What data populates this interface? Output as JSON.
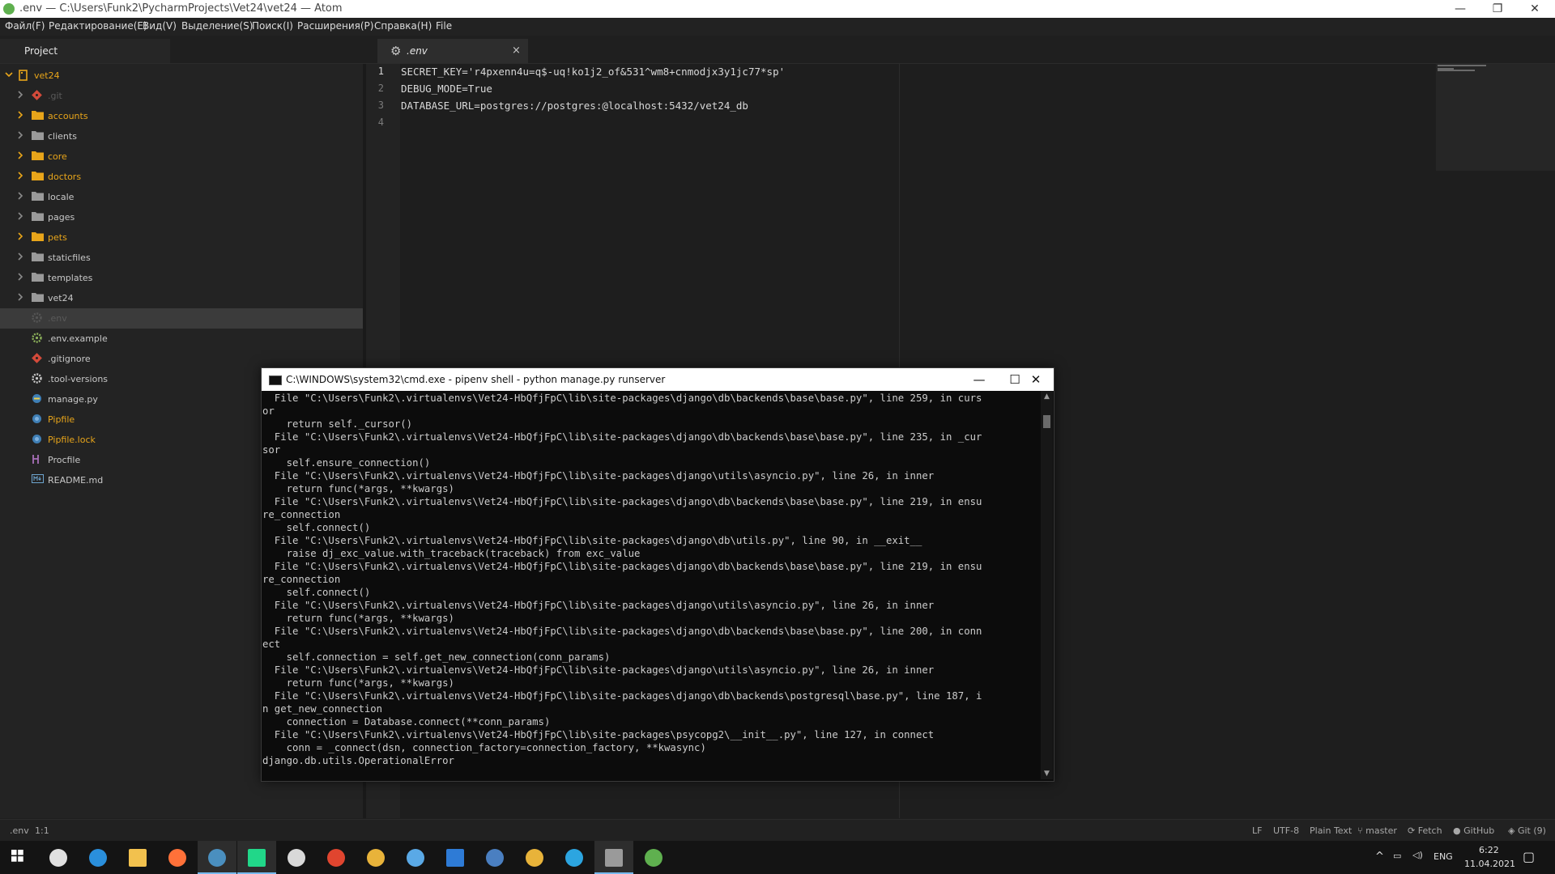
{
  "window": {
    "title": ".env — C:\\Users\\Funk2\\PycharmProjects\\Vet24\\vet24 — Atom",
    "min_glyph": "—",
    "max_glyph": "❐",
    "close_glyph": "✕"
  },
  "menu": [
    "Файл(F)",
    "Редактирование(E)",
    "Вид(V)",
    "Выделение(S)",
    "Поиск(I)",
    "Расширения(P)",
    "Справка(H)",
    "File"
  ],
  "sidebar": {
    "tab_label": "Project",
    "root": "vet24",
    "items": [
      {
        "label": ".git",
        "kind": "git",
        "color": "#5a5a5a",
        "chevron": true
      },
      {
        "label": "accounts",
        "kind": "folder-orange",
        "color": "#e8a51a",
        "chevron": true
      },
      {
        "label": "clients",
        "kind": "folder-gray",
        "color": "#c8c8c8",
        "chevron": true
      },
      {
        "label": "core",
        "kind": "folder-orange",
        "color": "#e8a51a",
        "chevron": true
      },
      {
        "label": "doctors",
        "kind": "folder-orange",
        "color": "#e8a51a",
        "chevron": true
      },
      {
        "label": "locale",
        "kind": "folder-gray",
        "color": "#c8c8c8",
        "chevron": true
      },
      {
        "label": "pages",
        "kind": "folder-gray",
        "color": "#c8c8c8",
        "chevron": true
      },
      {
        "label": "pets",
        "kind": "folder-orange",
        "color": "#e8a51a",
        "chevron": true
      },
      {
        "label": "staticfiles",
        "kind": "folder-gray",
        "color": "#c8c8c8",
        "chevron": true
      },
      {
        "label": "templates",
        "kind": "folder-gray",
        "color": "#c8c8c8",
        "chevron": true
      },
      {
        "label": "vet24",
        "kind": "folder-gray",
        "color": "#c8c8c8",
        "chevron": true
      },
      {
        "label": ".env",
        "kind": "gear-dim",
        "color": "#5a5a5a",
        "chevron": false,
        "selected": true
      },
      {
        "label": ".env.example",
        "kind": "gear-green",
        "color": "#c8c8c8",
        "chevron": false
      },
      {
        "label": ".gitignore",
        "kind": "git",
        "color": "#c8c8c8",
        "chevron": false
      },
      {
        "label": ".tool-versions",
        "kind": "gear",
        "color": "#c8c8c8",
        "chevron": false
      },
      {
        "label": "manage.py",
        "kind": "python",
        "color": "#c8c8c8",
        "chevron": false
      },
      {
        "label": "Pipfile",
        "kind": "pipfile",
        "color": "#e8a51a",
        "chevron": false
      },
      {
        "label": "Pipfile.lock",
        "kind": "pipfile",
        "color": "#e8a51a",
        "chevron": false
      },
      {
        "label": "Procfile",
        "kind": "procfile",
        "color": "#c8c8c8",
        "chevron": false
      },
      {
        "label": "README.md",
        "kind": "markdown",
        "color": "#c8c8c8",
        "chevron": false
      }
    ]
  },
  "editor": {
    "tab_label": ".env",
    "close_glyph": "×",
    "gear_glyph": "⚙",
    "lines": [
      "SECRET_KEY='r4pxenn4u=q$-uq!ko1j2_of&531^wm8+cnmodjx3y1jc77*sp'",
      "DEBUG_MODE=True",
      "DATABASE_URL=postgres://postgres:@localhost:5432/vet24_db",
      ""
    ]
  },
  "status": {
    "file": ".env",
    "cursor": "1:1",
    "eol": "LF",
    "encoding": "UTF-8",
    "grammar": "Plain Text",
    "branch": "master",
    "fetch": "Fetch",
    "github": "GitHub",
    "git": "Git (9)"
  },
  "terminal": {
    "title": "C:\\WINDOWS\\system32\\cmd.exe - pipenv  shell - python  manage.py runserver",
    "min_glyph": "—",
    "max_glyph": "☐",
    "close_glyph": "✕",
    "lines": [
      "  File \"C:\\Users\\Funk2\\.virtualenvs\\Vet24-HbQfjFpC\\lib\\site-packages\\django\\db\\backends\\base\\base.py\", line 259, in curs",
      "or",
      "    return self._cursor()",
      "  File \"C:\\Users\\Funk2\\.virtualenvs\\Vet24-HbQfjFpC\\lib\\site-packages\\django\\db\\backends\\base\\base.py\", line 235, in _cur",
      "sor",
      "    self.ensure_connection()",
      "  File \"C:\\Users\\Funk2\\.virtualenvs\\Vet24-HbQfjFpC\\lib\\site-packages\\django\\utils\\asyncio.py\", line 26, in inner",
      "    return func(*args, **kwargs)",
      "  File \"C:\\Users\\Funk2\\.virtualenvs\\Vet24-HbQfjFpC\\lib\\site-packages\\django\\db\\backends\\base\\base.py\", line 219, in ensu",
      "re_connection",
      "    self.connect()",
      "  File \"C:\\Users\\Funk2\\.virtualenvs\\Vet24-HbQfjFpC\\lib\\site-packages\\django\\db\\utils.py\", line 90, in __exit__",
      "    raise dj_exc_value.with_traceback(traceback) from exc_value",
      "  File \"C:\\Users\\Funk2\\.virtualenvs\\Vet24-HbQfjFpC\\lib\\site-packages\\django\\db\\backends\\base\\base.py\", line 219, in ensu",
      "re_connection",
      "    self.connect()",
      "  File \"C:\\Users\\Funk2\\.virtualenvs\\Vet24-HbQfjFpC\\lib\\site-packages\\django\\utils\\asyncio.py\", line 26, in inner",
      "    return func(*args, **kwargs)",
      "  File \"C:\\Users\\Funk2\\.virtualenvs\\Vet24-HbQfjFpC\\lib\\site-packages\\django\\db\\backends\\base\\base.py\", line 200, in conn",
      "ect",
      "    self.connection = self.get_new_connection(conn_params)",
      "  File \"C:\\Users\\Funk2\\.virtualenvs\\Vet24-HbQfjFpC\\lib\\site-packages\\django\\utils\\asyncio.py\", line 26, in inner",
      "    return func(*args, **kwargs)",
      "  File \"C:\\Users\\Funk2\\.virtualenvs\\Vet24-HbQfjFpC\\lib\\site-packages\\django\\db\\backends\\postgresql\\base.py\", line 187, i",
      "n get_new_connection",
      "    connection = Database.connect(**conn_params)",
      "  File \"C:\\Users\\Funk2\\.virtualenvs\\Vet24-HbQfjFpC\\lib\\site-packages\\psycopg2\\__init__.py\", line 127, in connect",
      "    conn = _connect(dsn, connection_factory=connection_factory, **kwasync)",
      "django.db.utils.OperationalError"
    ]
  },
  "taskbar": {
    "apps": [
      {
        "name": "task-view",
        "color": "#e0e0e0"
      },
      {
        "name": "edge",
        "color": "#2a8fdc"
      },
      {
        "name": "file-explorer",
        "color": "#f2c14e"
      },
      {
        "name": "firefox",
        "color": "#ff7139"
      },
      {
        "name": "steam",
        "color": "#4a8fbf"
      },
      {
        "name": "pycharm",
        "color": "#21d789"
      },
      {
        "name": "xbox",
        "color": "#d9d9d9"
      },
      {
        "name": "app-red",
        "color": "#e0452f"
      },
      {
        "name": "chrome",
        "color": "#e8b33a"
      },
      {
        "name": "app-drop",
        "color": "#5aa9e6"
      },
      {
        "name": "mail",
        "color": "#2e7bd6"
      },
      {
        "name": "qbittorrent",
        "color": "#4a7fc1"
      },
      {
        "name": "chrome-2",
        "color": "#e8b33a"
      },
      {
        "name": "telegram",
        "color": "#2ca5e0"
      },
      {
        "name": "terminal",
        "color": "#9a9a9a"
      },
      {
        "name": "atom",
        "color": "#5fb04f"
      }
    ],
    "lang": "ENG",
    "time": "6:22",
    "date": "11.04.2021",
    "tray_up_glyph": "^"
  }
}
